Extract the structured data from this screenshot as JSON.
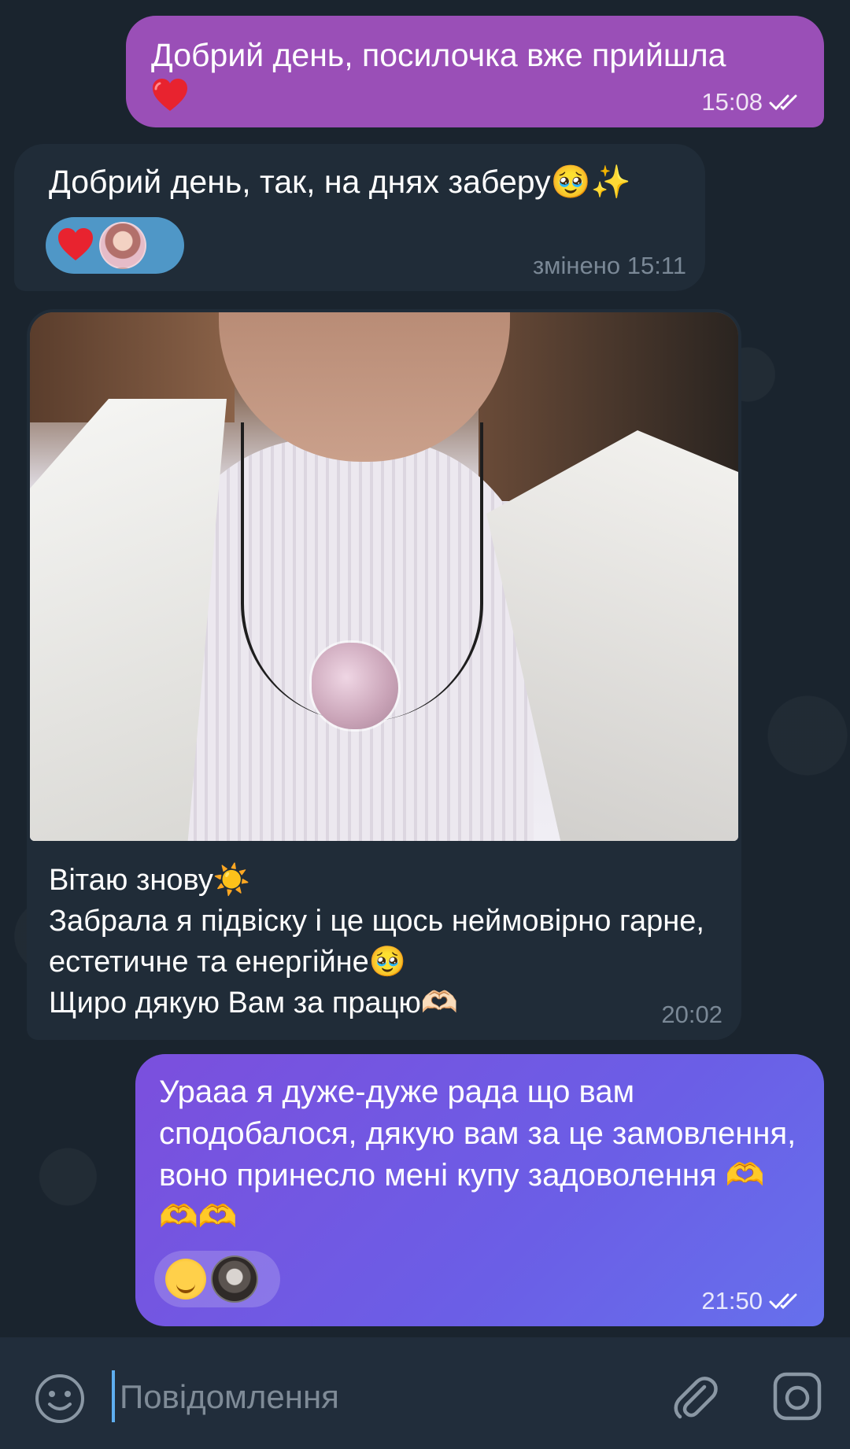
{
  "messages": [
    {
      "direction": "outgoing",
      "text": "Добрий день, посилочка вже прийшла",
      "emoji": "heart",
      "time": "15:08",
      "status": "read"
    },
    {
      "direction": "incoming",
      "text": "Добрий день, так, на днях заберу🥹✨",
      "reaction": "heart",
      "edited_time": "змінено 15:11"
    },
    {
      "direction": "incoming",
      "has_photo": true,
      "caption": "Вітаю знову☀️\nЗабрала я підвіску і це щось неймовірно гарне, естетичне та енергійне🥹\nЩиро дякую Вам за працю🫶🏻",
      "time": "20:02"
    },
    {
      "direction": "outgoing",
      "text": "Урааа я дуже-дуже рада що вам сподобалося, дякую вам за це замовлення, воно принесло мені купу задоволення 🫶🫶🫶",
      "reaction": "smiling-face-with-hearts",
      "time": "21:50",
      "status": "read"
    }
  ],
  "composer": {
    "placeholder": "Повідомлення"
  },
  "icons": {
    "emoji": "smile-icon",
    "attach": "paperclip-icon",
    "camera": "camera-icon"
  },
  "colors": {
    "outgoing_1": "#9a4fb7",
    "outgoing_2": "#6b5ee6",
    "incoming": "#202c38",
    "background": "#17212b",
    "accent": "#5eaef0"
  }
}
